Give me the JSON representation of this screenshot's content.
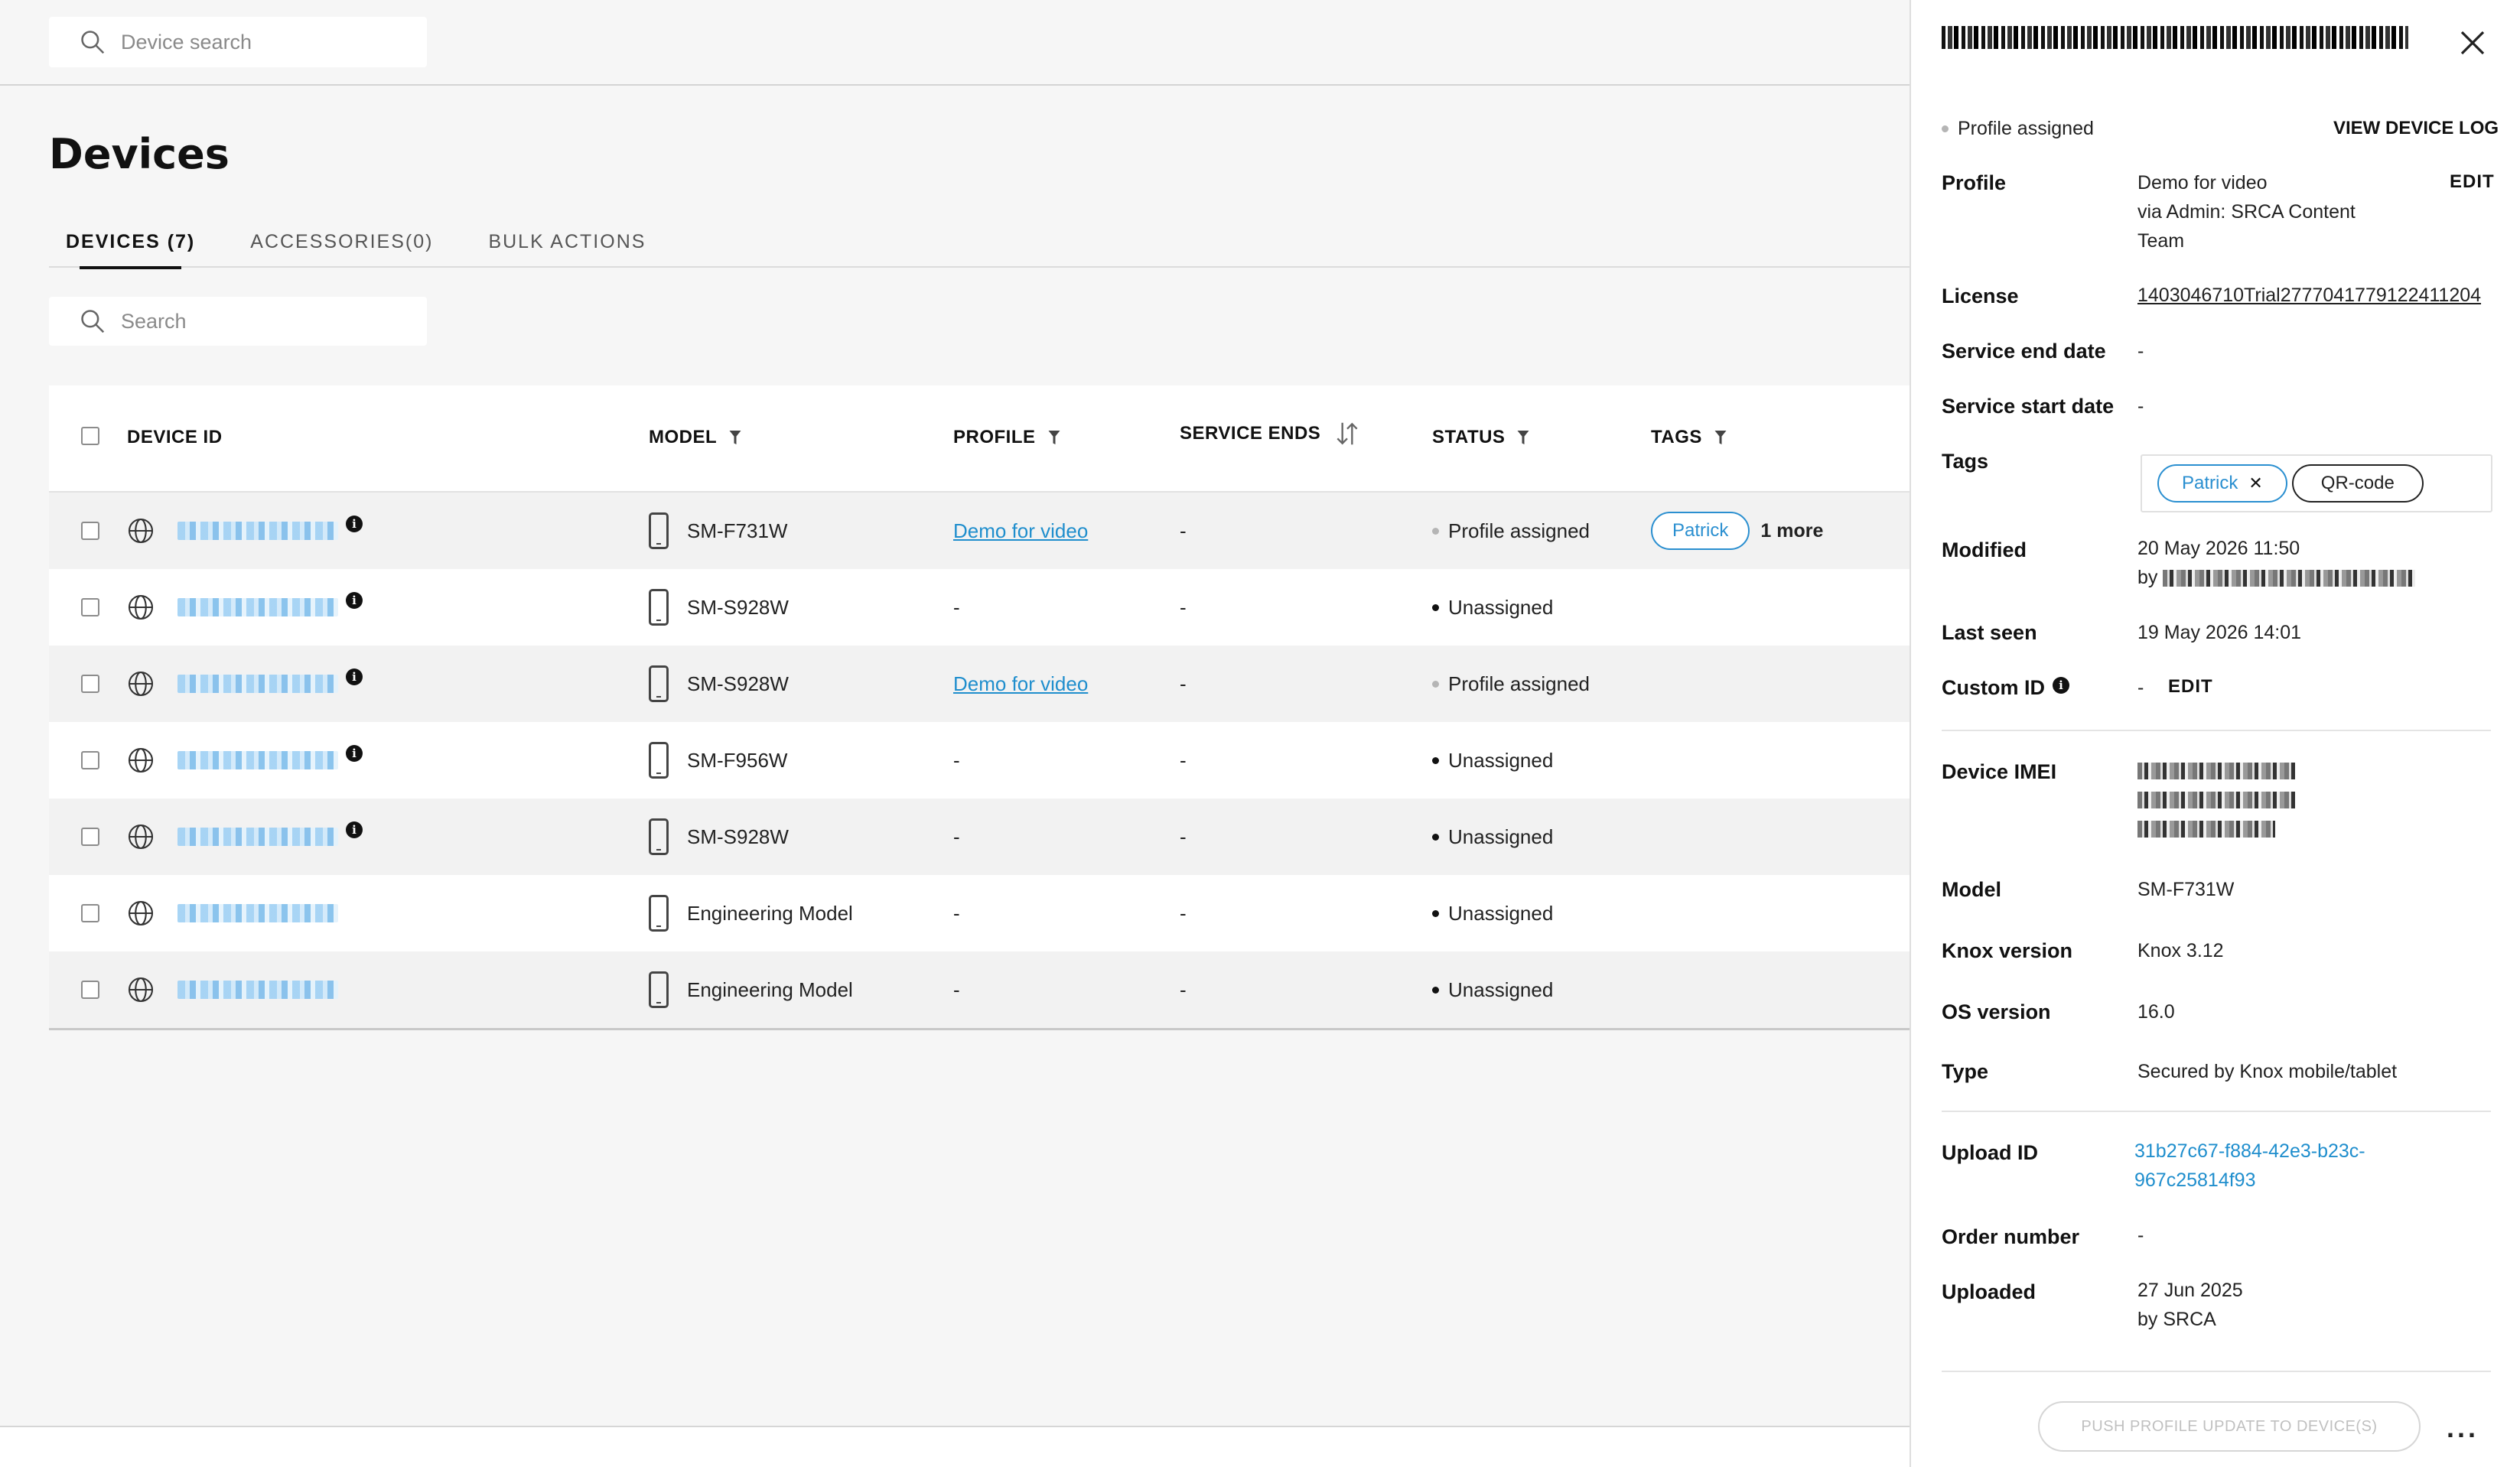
{
  "top_search": {
    "placeholder": "Device search"
  },
  "page": {
    "title": "Devices"
  },
  "tabs": [
    {
      "label": "DEVICES (7)",
      "active": true
    },
    {
      "label": "ACCESSORIES(0)",
      "active": false
    },
    {
      "label": "BULK ACTIONS",
      "active": false
    }
  ],
  "table_search": {
    "placeholder": "Search"
  },
  "table": {
    "headers": {
      "device_id": "DEVICE ID",
      "model": "MODEL",
      "profile": "PROFILE",
      "service_ends": "SERVICE ENDS",
      "status": "STATUS",
      "tags": "TAGS"
    },
    "rows": [
      {
        "model": "SM-F731W",
        "profile": "Demo for video",
        "service_ends": "-",
        "status": "Profile assigned",
        "tag": "Patrick",
        "more": "1 more"
      },
      {
        "model": "SM-S928W",
        "profile": "-",
        "service_ends": "-",
        "status": "Unassigned"
      },
      {
        "model": "SM-S928W",
        "profile": "Demo for video",
        "service_ends": "-",
        "status": "Profile assigned"
      },
      {
        "model": "SM-F956W",
        "profile": "-",
        "service_ends": "-",
        "status": "Unassigned"
      },
      {
        "model": "SM-S928W",
        "profile": "-",
        "service_ends": "-",
        "status": "Unassigned"
      },
      {
        "model": "Engineering Model",
        "profile": "-",
        "service_ends": "-",
        "status": "Unassigned"
      },
      {
        "model": "Engineering Model",
        "profile": "-",
        "service_ends": "-",
        "status": "Unassigned"
      }
    ]
  },
  "panel": {
    "status": "Profile assigned",
    "view_log": "VIEW DEVICE LOG",
    "profile_label": "Profile",
    "profile_value_1": "Demo for video",
    "profile_value_2": "via Admin: SRCA Content",
    "profile_value_3": "Team",
    "edit": "EDIT",
    "license_label": "License",
    "license_value": "1403046710Trial2777041779122411204",
    "service_end_label": "Service end date",
    "service_end_value": "-",
    "service_start_label": "Service start date",
    "service_start_value": "-",
    "tags_label": "Tags",
    "tag_1": "Patrick",
    "tag_2": "QR-code",
    "modified_label": "Modified",
    "modified_value": "20 May 2026 11:50",
    "modified_by": "by",
    "last_seen_label": "Last seen",
    "last_seen_value": "19 May 2026 14:01",
    "custom_id_label": "Custom ID",
    "custom_id_value": "-",
    "custom_id_edit": "EDIT",
    "imei_label": "Device IMEI",
    "model_label": "Model",
    "model_value": "SM-F731W",
    "knox_label": "Knox version",
    "knox_value": "Knox 3.12",
    "os_label": "OS version",
    "os_value": "16.0",
    "type_label": "Type",
    "type_value": "Secured by Knox mobile/tablet",
    "upload_id_label": "Upload ID",
    "upload_id_1": "31b27c67-f884-42e3-b23c-",
    "upload_id_2": "967c25814f93",
    "order_label": "Order number",
    "order_value": "-",
    "uploaded_label": "Uploaded",
    "uploaded_value": "27 Jun 2025",
    "uploaded_by": "by SRCA",
    "push_button": "PUSH PROFILE UPDATE TO DEVICE(S)",
    "more_actions": "..."
  },
  "colors": {
    "accent": "#1f8ecd",
    "text": "#1a1a1a",
    "background": "#f6f6f6"
  }
}
